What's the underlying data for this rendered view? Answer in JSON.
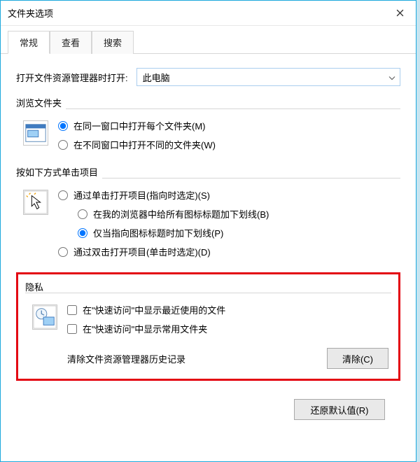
{
  "window": {
    "title": "文件夹选项"
  },
  "tabs": {
    "items": [
      {
        "label": "常规",
        "active": true
      },
      {
        "label": "查看",
        "active": false
      },
      {
        "label": "搜索",
        "active": false
      }
    ]
  },
  "open_with": {
    "label": "打开文件资源管理器时打开:",
    "selected": "此电脑"
  },
  "browse_group": {
    "title": "浏览文件夹",
    "options": [
      {
        "label": "在同一窗口中打开每个文件夹(M)",
        "checked": true
      },
      {
        "label": "在不同窗口中打开不同的文件夹(W)",
        "checked": false
      }
    ]
  },
  "click_group": {
    "title": "按如下方式单击项目",
    "opt1": {
      "label": "通过单击打开项目(指向时选定)(S)",
      "checked": false
    },
    "sub1": {
      "label": "在我的浏览器中给所有图标标题加下划线(B)",
      "checked": false
    },
    "sub2": {
      "label": "仅当指向图标标题时加下划线(P)",
      "checked": true
    },
    "opt2": {
      "label": "通过双击打开项目(单击时选定)(D)",
      "checked": false
    }
  },
  "privacy_group": {
    "title": "隐私",
    "check1": {
      "label": "在\"快速访问\"中显示最近使用的文件",
      "checked": false
    },
    "check2": {
      "label": "在\"快速访问\"中显示常用文件夹",
      "checked": false
    },
    "clear_label": "清除文件资源管理器历史记录",
    "clear_button": "清除(C)"
  },
  "footer": {
    "restore_defaults": "还原默认值(R)"
  },
  "colors": {
    "accent": "#1ca8dd",
    "highlight": "#e30613"
  }
}
